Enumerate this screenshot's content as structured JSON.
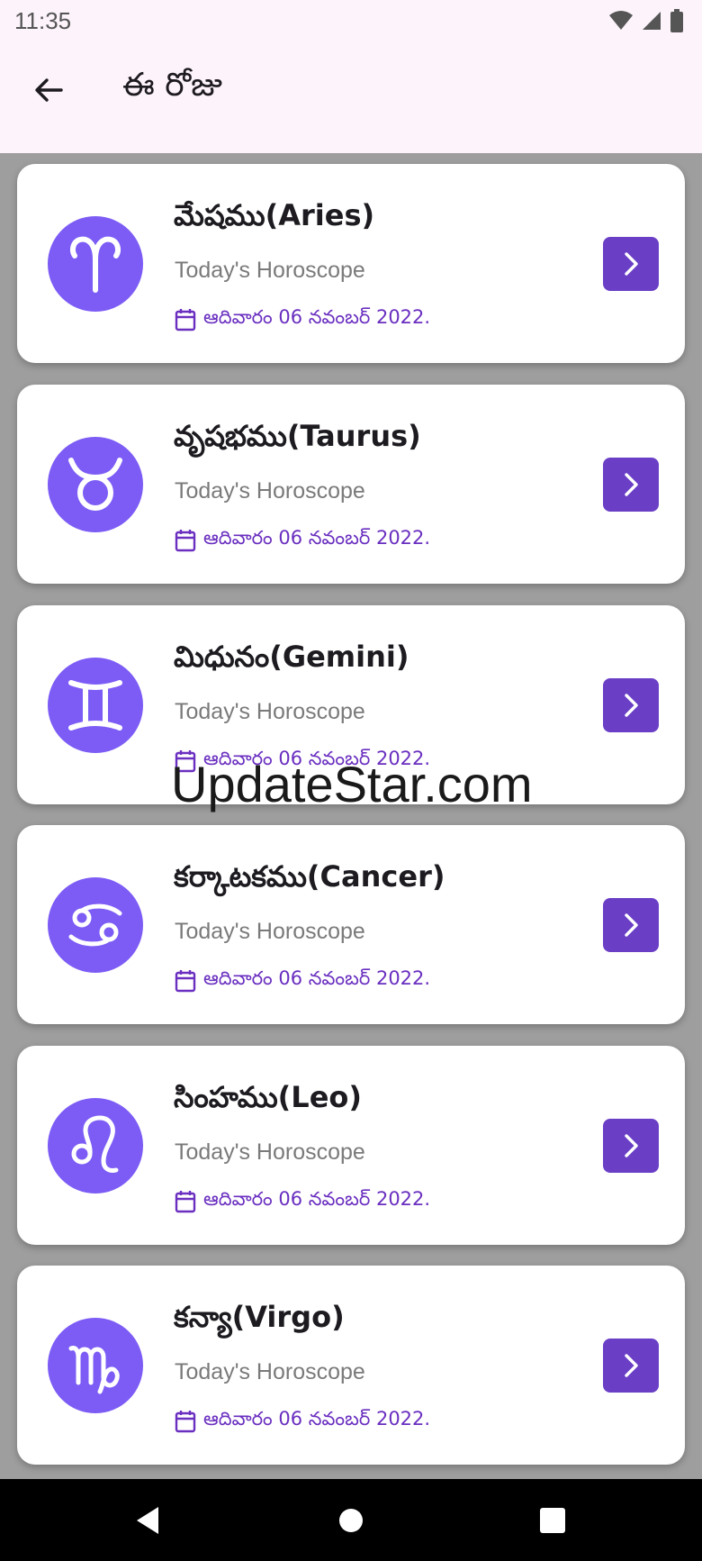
{
  "status_bar": {
    "time": "11:35",
    "icons": [
      "wifi-icon",
      "signal-icon",
      "battery-icon"
    ]
  },
  "app_bar": {
    "title": "ఈ రోజు",
    "back_icon": "arrow-left-icon"
  },
  "colors": {
    "accent": "#7c5cf5",
    "button": "#6a3fc6",
    "date_text": "#6a2fc0",
    "app_bar_bg": "#fdf3fb"
  },
  "horoscopes": [
    {
      "name": "మేషము(Aries)",
      "subtitle": "Today's Horoscope",
      "date": "ఆదివారం 06 నవంబర్ 2022.",
      "icon": "aries-icon"
    },
    {
      "name": "వృషభము(Taurus)",
      "subtitle": "Today's Horoscope",
      "date": "ఆదివారం 06 నవంబర్ 2022.",
      "icon": "taurus-icon"
    },
    {
      "name": "మిధునం(Gemini)",
      "subtitle": "Today's Horoscope",
      "date": "ఆదివారం 06 నవంబర్ 2022.",
      "icon": "gemini-icon"
    },
    {
      "name": "కర్కాటకము(Cancer)",
      "subtitle": "Today's Horoscope",
      "date": "ఆదివారం 06 నవంబర్ 2022.",
      "icon": "cancer-icon"
    },
    {
      "name": "సింహము(Leo)",
      "subtitle": "Today's Horoscope",
      "date": "ఆదివారం 06 నవంబర్ 2022.",
      "icon": "leo-icon"
    },
    {
      "name": "కన్యా(Virgo)",
      "subtitle": "Today's Horoscope",
      "date": "ఆదివారం 06 నవంబర్ 2022.",
      "icon": "virgo-icon"
    }
  ],
  "watermark": "UpdateStar.com",
  "nav_bar": {
    "icons": [
      "back-triangle-icon",
      "home-circle-icon",
      "recents-square-icon"
    ]
  }
}
